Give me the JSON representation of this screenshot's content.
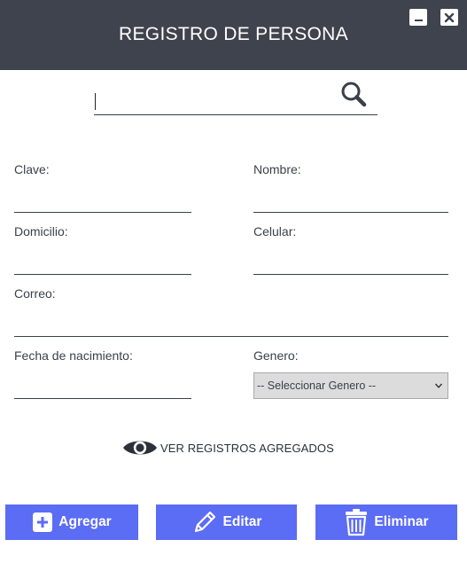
{
  "window": {
    "title": "REGISTRO DE PERSONA",
    "header_color": "#3e434d"
  },
  "search": {
    "value": "",
    "placeholder": ""
  },
  "form": {
    "clave": {
      "label": "Clave:",
      "value": ""
    },
    "nombre": {
      "label": "Nombre:",
      "value": ""
    },
    "domicilio": {
      "label": "Domicilio:",
      "value": ""
    },
    "celular": {
      "label": "Celular:",
      "value": ""
    },
    "correo": {
      "label": "Correo:",
      "value": ""
    },
    "fecha": {
      "label": "Fecha de nacimiento:",
      "value": ""
    },
    "genero": {
      "label": "Genero:",
      "selected": "-- Seleccionar Genero --"
    }
  },
  "view_link": {
    "label": "VER REGISTROS AGREGADOS",
    "icon": "eye-icon"
  },
  "buttons": {
    "add": {
      "label": "Agregar",
      "icon": "plus-square-icon"
    },
    "edit": {
      "label": "Editar",
      "icon": "pencil-icon"
    },
    "delete": {
      "label": "Eliminar",
      "icon": "trash-icon"
    }
  },
  "colors": {
    "accent": "#5b6cf5",
    "text": "#3a3f4a"
  }
}
